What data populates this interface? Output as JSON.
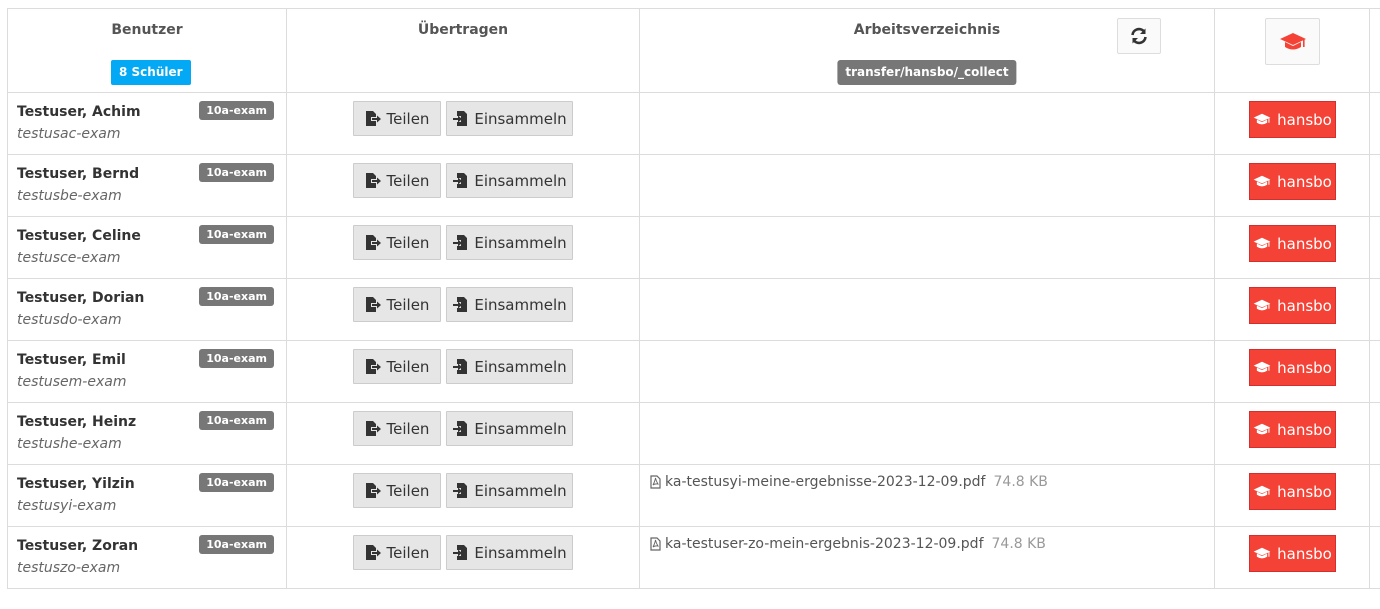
{
  "header": {
    "col_user": "Benutzer",
    "student_count_badge": "8 Schüler",
    "col_transfer": "Übertragen",
    "col_dir": "Arbeitsverzeichnis",
    "dir_path_badge": "transfer/hansbo/_collect"
  },
  "buttons": {
    "share_label": "Teilen",
    "collect_label": "Einsammeln"
  },
  "colors": {
    "primary_badge": "#03a9f4",
    "danger": "#f44336",
    "label_gray": "#777777"
  },
  "rows": [
    {
      "name": "Testuser, Achim",
      "login": "testusac-exam",
      "group": "10a-exam",
      "file": "",
      "file_size": "",
      "exam_user": "hansbo"
    },
    {
      "name": "Testuser, Bernd",
      "login": "testusbe-exam",
      "group": "10a-exam",
      "file": "",
      "file_size": "",
      "exam_user": "hansbo"
    },
    {
      "name": "Testuser, Celine",
      "login": "testusce-exam",
      "group": "10a-exam",
      "file": "",
      "file_size": "",
      "exam_user": "hansbo"
    },
    {
      "name": "Testuser, Dorian",
      "login": "testusdo-exam",
      "group": "10a-exam",
      "file": "",
      "file_size": "",
      "exam_user": "hansbo"
    },
    {
      "name": "Testuser, Emil",
      "login": "testusem-exam",
      "group": "10a-exam",
      "file": "",
      "file_size": "",
      "exam_user": "hansbo"
    },
    {
      "name": "Testuser, Heinz",
      "login": "testushe-exam",
      "group": "10a-exam",
      "file": "",
      "file_size": "",
      "exam_user": "hansbo"
    },
    {
      "name": "Testuser, Yilzin",
      "login": "testusyi-exam",
      "group": "10a-exam",
      "file": "ka-testusyi-meine-ergebnisse-2023-12-09.pdf",
      "file_size": "74.8 KB",
      "exam_user": "hansbo"
    },
    {
      "name": "Testuser, Zoran",
      "login": "testuszo-exam",
      "group": "10a-exam",
      "file": "ka-testuser-zo-mein-ergebnis-2023-12-09.pdf",
      "file_size": "74.8 KB",
      "exam_user": "hansbo"
    }
  ]
}
